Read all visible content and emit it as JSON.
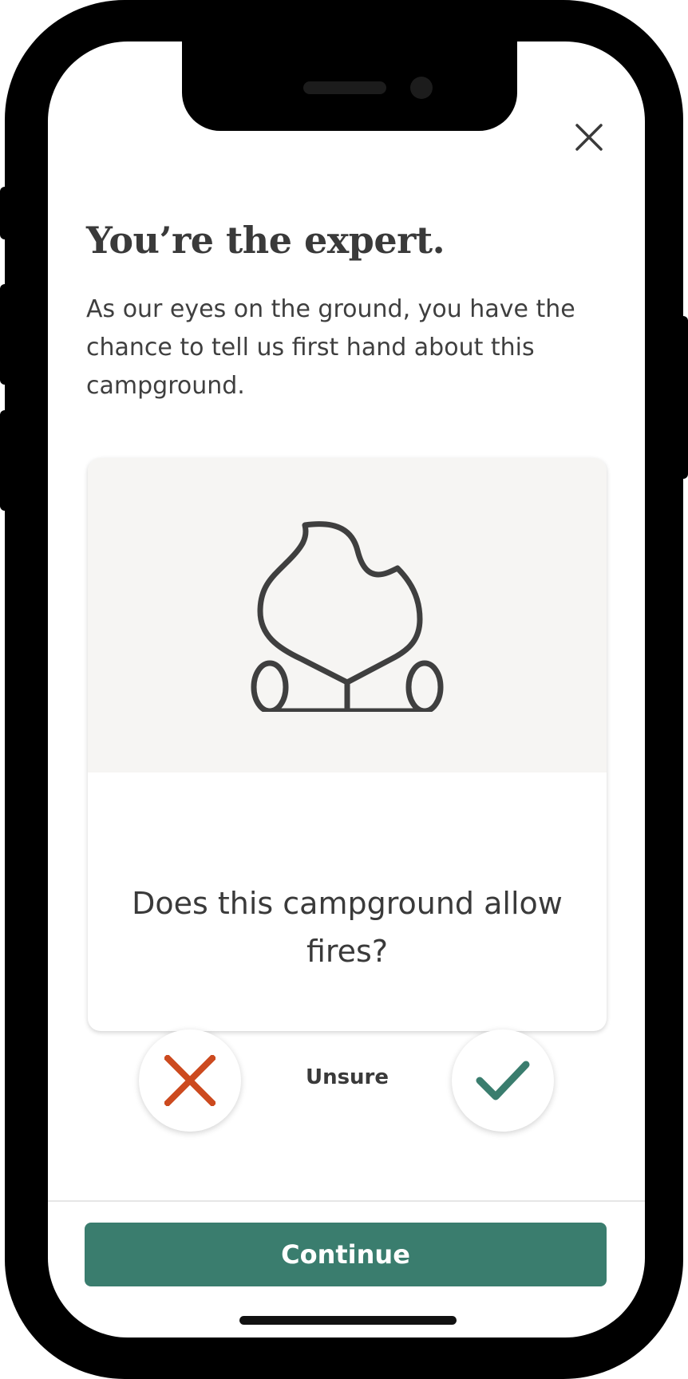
{
  "header": {
    "close_icon": "close-icon"
  },
  "intro": {
    "title": "You’re the expert.",
    "body": "As our eyes on the ground, you have the chance to tell us first hand about this campground."
  },
  "card": {
    "illustration_icon": "campfire-icon",
    "question": "Does this campground allow fires?"
  },
  "answers": {
    "no_icon": "x-icon",
    "unsure_label": "Unsure",
    "yes_icon": "checkmark-icon"
  },
  "footer": {
    "continue_label": "Continue"
  },
  "colors": {
    "accent": "#3a7d6e",
    "no": "#cc4a1f",
    "yes": "#3a7d6e",
    "text": "#3a3a3a",
    "card_bg": "#f6f5f3"
  }
}
